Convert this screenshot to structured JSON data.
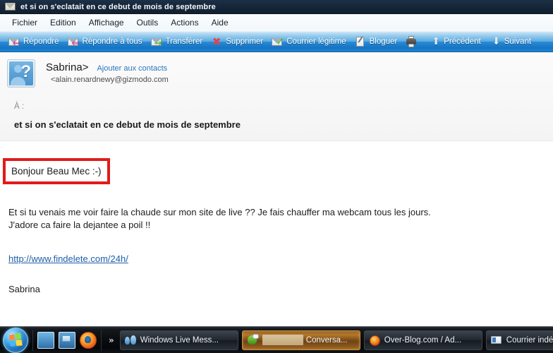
{
  "window": {
    "title": "et si on s'eclatait en ce debut de mois de septembre",
    "icon": "envelope-icon"
  },
  "menubar": {
    "items": [
      {
        "label": "Fichier"
      },
      {
        "label": "Edition"
      },
      {
        "label": "Affichage"
      },
      {
        "label": "Outils"
      },
      {
        "label": "Actions"
      },
      {
        "label": "Aide"
      }
    ]
  },
  "toolbar": {
    "items": [
      {
        "label": "Répondre",
        "icon": "reply-icon"
      },
      {
        "label": "Répondre à tous",
        "icon": "reply-all-icon"
      },
      {
        "label": "Transférer",
        "icon": "forward-icon"
      },
      {
        "label": "Supprimer",
        "icon": "delete-icon"
      },
      {
        "label": "Courrier légitime",
        "icon": "not-junk-icon"
      },
      {
        "label": "Bloguer",
        "icon": "blog-icon"
      },
      {
        "label": "",
        "icon": "printer-icon"
      },
      {
        "label": "Précédent",
        "icon": "arrow-up-icon"
      },
      {
        "label": "Suivant",
        "icon": "arrow-down-icon"
      }
    ]
  },
  "message": {
    "sender_name": "Sabrina>",
    "add_contact_link": "Ajouter aux contacts",
    "sender_email": "<alain.renardnewy@gizmodo.com",
    "to_label": "À :",
    "to_value": "",
    "subject": "et si on s'eclatait en ce debut de mois de septembre",
    "avatar_icon": "unknown-contact-icon",
    "body": {
      "greeting": "Bonjour Beau Mec :-)",
      "paragraph_line1": "Et si tu venais me voir faire la chaude sur mon site de live ?? Je fais chauffer ma webcam tous les jours.",
      "paragraph_line2": "J'adore ca faire la dejantee a poil !!",
      "link": "http://www.findelete.com/24h/",
      "signature": "Sabrina"
    },
    "highlight_color": "#e01b1b"
  },
  "taskbar": {
    "start_label": "",
    "quick_launch": [
      {
        "icon": "show-desktop-icon"
      },
      {
        "icon": "switch-windows-icon"
      },
      {
        "icon": "firefox-icon"
      }
    ],
    "overflow_label": "»",
    "buttons": [
      {
        "label": "Windows Live Mess...",
        "icon": "messenger-contacts-icon",
        "active": false
      },
      {
        "label": "Conversa...",
        "icon": "messenger-icon",
        "active": true
      },
      {
        "label": "Over-Blog.com / Ad...",
        "icon": "firefox-icon",
        "active": false
      },
      {
        "label": "Courrier indé...",
        "icon": "mail-window-icon",
        "active": false
      }
    ]
  }
}
